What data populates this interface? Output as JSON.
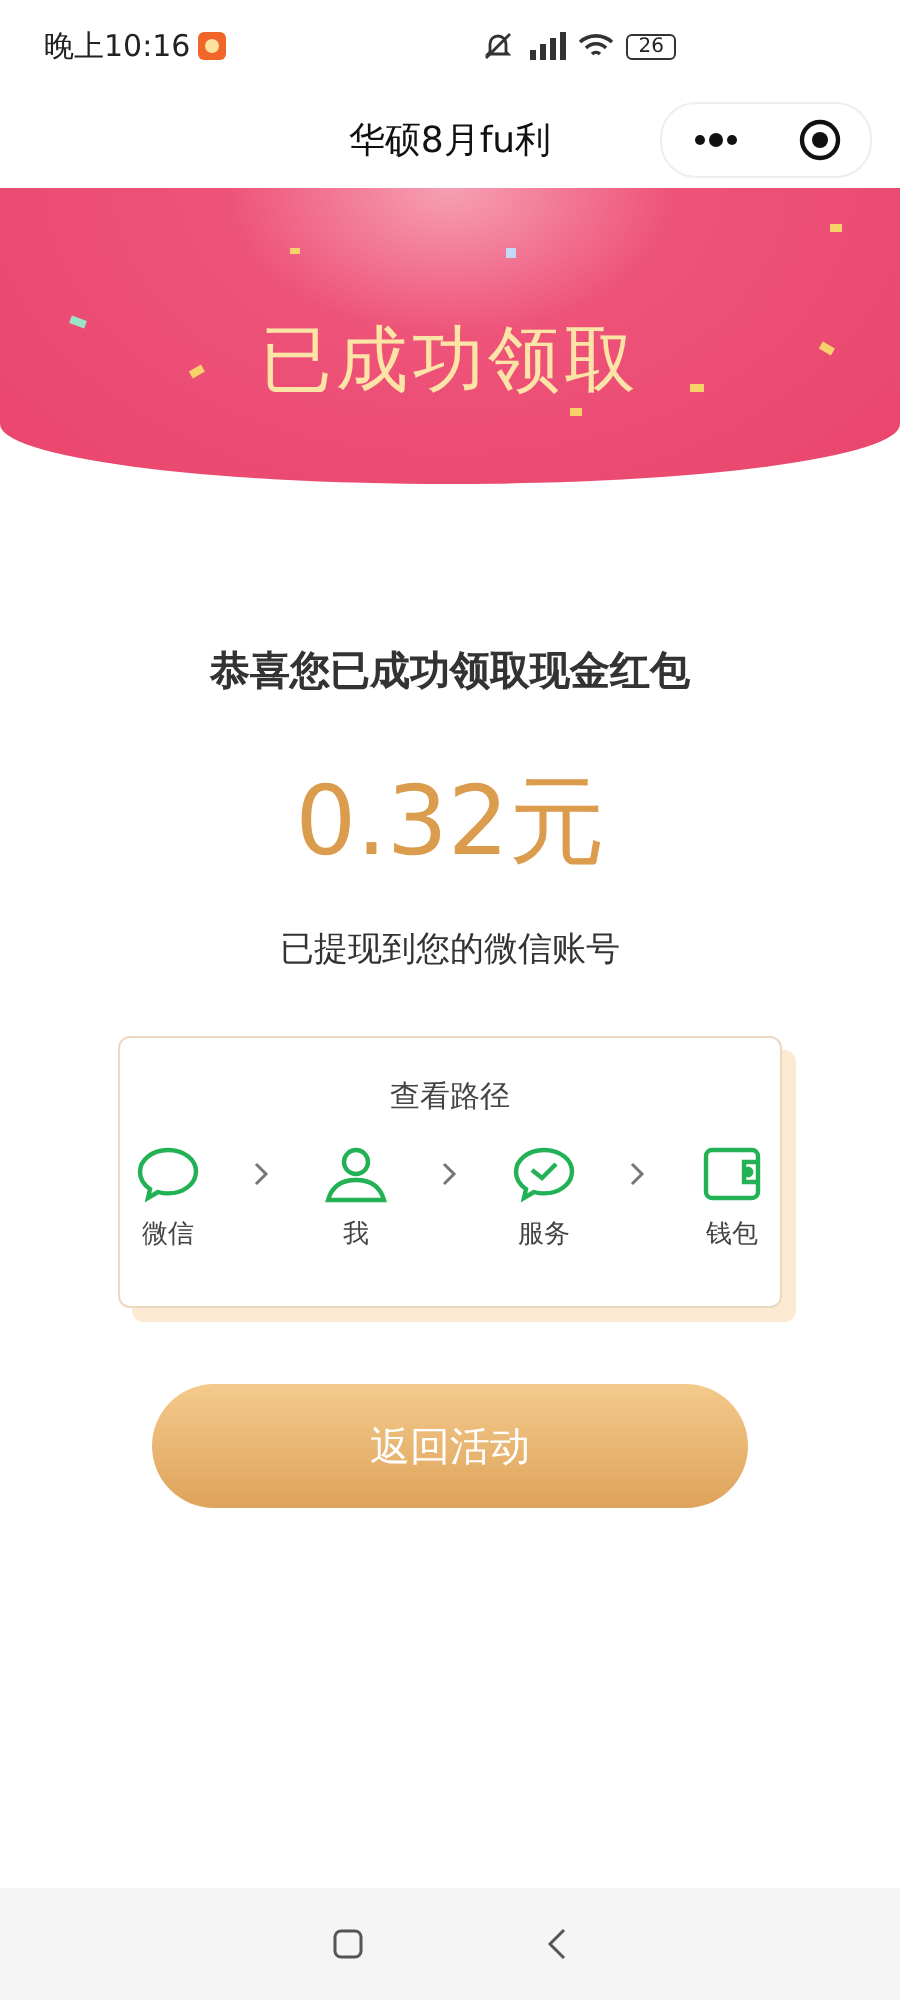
{
  "status_bar": {
    "time": "晚上10:16",
    "battery": "26"
  },
  "nav": {
    "title": "华硕8月fu利"
  },
  "banner": {
    "title": "已成功领取"
  },
  "result": {
    "message": "恭喜您已成功领取现金红包",
    "amount": "0.32元",
    "note": "已提现到您的微信账号"
  },
  "path_card": {
    "title": "查看路径",
    "steps": [
      {
        "label": "微信",
        "kind": "chat"
      },
      {
        "label": "我",
        "kind": "person"
      },
      {
        "label": "服务",
        "kind": "check"
      },
      {
        "label": "钱包",
        "kind": "wallet"
      }
    ]
  },
  "return_button": "返回活动"
}
